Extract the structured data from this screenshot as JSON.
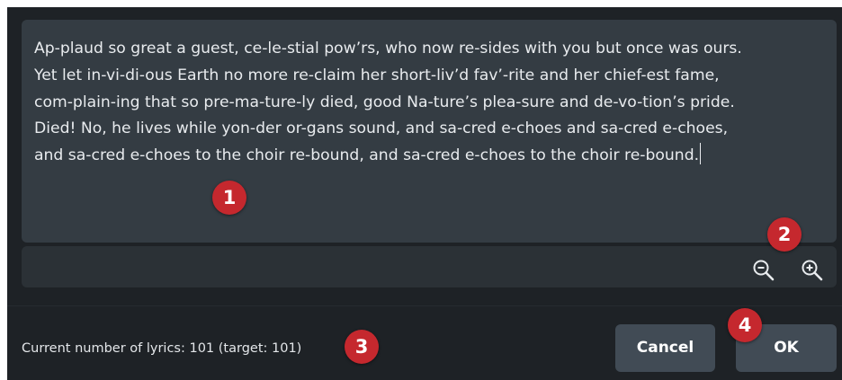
{
  "colors": {
    "dialog_bg": "#1e2226",
    "editor_bg": "#343c43",
    "button_bg": "#414b55",
    "callout_red": "#c5282e"
  },
  "editor": {
    "lines": [
      "Ap-plaud so great a guest, ce-le-stial pow’rs, who now re-sides with you but once was ours.",
      "Yet let in-vi-di-ous Earth no more re-claim her short-liv’d fav’-rite and her chief-est fame,",
      "com-plain-ing that so pre-ma-ture-ly died, good Na-ture’s plea-sure and de-vo-tion’s pride.",
      "Died! No, he lives while yon-der or-gans sound, and sa-cred e-choes and sa-cred e-choes,",
      "and sa-cred e-choes to the choir re-bound, and sa-cred e-choes to the choir re-bound."
    ]
  },
  "zoom": {
    "zoom_out_icon": "zoom-out-icon",
    "zoom_in_icon": "zoom-in-icon"
  },
  "status": {
    "lyrics_count": "Current number of lyrics: 101 (target: 101)"
  },
  "buttons": {
    "cancel": "Cancel",
    "ok": "OK"
  },
  "callouts": [
    "1",
    "2",
    "3",
    "4"
  ]
}
